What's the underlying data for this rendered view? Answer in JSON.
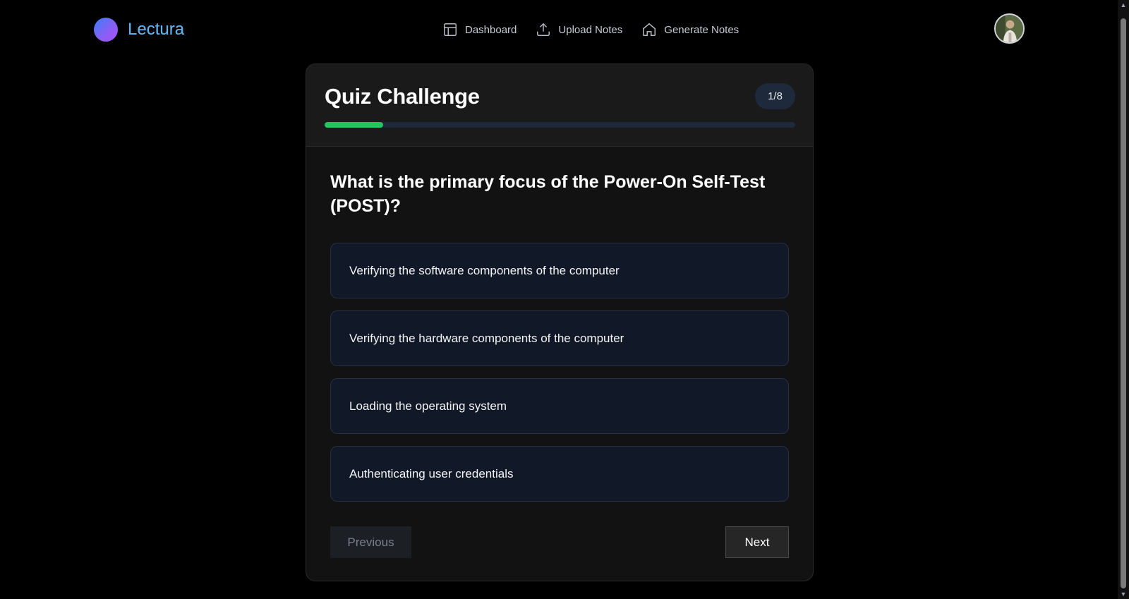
{
  "brand": {
    "name": "Lectura"
  },
  "nav": {
    "items": [
      {
        "label": "Dashboard",
        "icon": "layout-icon"
      },
      {
        "label": "Upload Notes",
        "icon": "upload-icon"
      },
      {
        "label": "Generate Notes",
        "icon": "home-icon"
      }
    ]
  },
  "quiz": {
    "title": "Quiz Challenge",
    "counter": "1/8",
    "progress_fraction": 0.125,
    "question": "What is the primary focus of the Power-On Self-Test (POST)?",
    "options": [
      "Verifying the software components of the computer",
      "Verifying the hardware components of the computer",
      "Loading the operating system",
      "Authenticating user credentials"
    ],
    "previous_label": "Previous",
    "next_label": "Next"
  },
  "colors": {
    "progress": "#22c55e",
    "background": "#000000",
    "card": "#121212"
  }
}
